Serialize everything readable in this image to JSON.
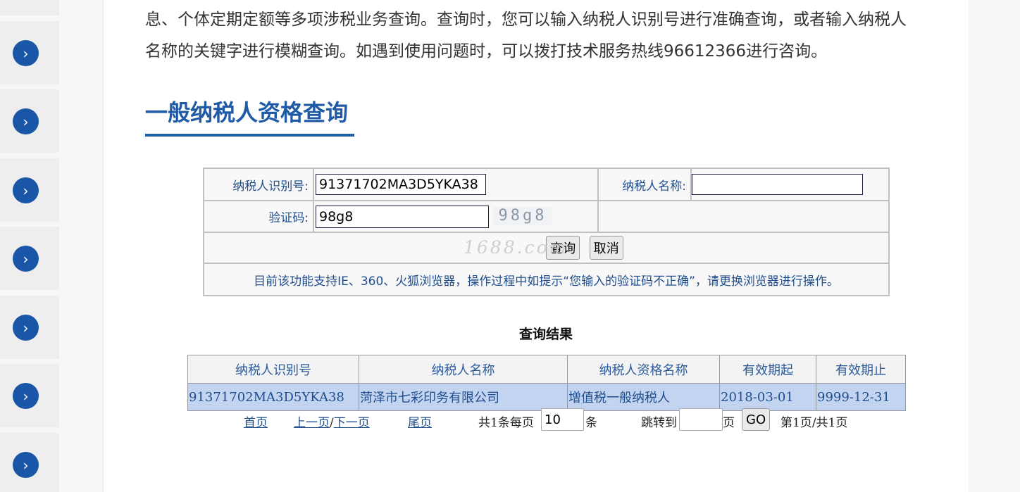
{
  "intro": {
    "line1": "息、个体定期定额等多项涉税业务查询。查询时，您可以输入纳税人识别号进行准确查询，或者输入纳税人",
    "line2": "名称的关键字进行模糊查询。如遇到使用问题时，可以拨打技术服务热线96612366进行咨询。"
  },
  "page_title": "一般纳税人资格查询",
  "form": {
    "taxpayer_id_label": "纳税人识别号:",
    "taxpayer_id_value": "91371702MA3D5YKA38",
    "taxpayer_name_label": "纳税人名称:",
    "taxpayer_name_value": "",
    "captcha_label": "验证码:",
    "captcha_value": "98g8",
    "captcha_image_text": "98g8",
    "query_button": "查询",
    "cancel_button": "取消",
    "notice": "目前该功能支持IE、360、火狐浏览器，操作过程中如提示“您输入的验证码不正确”，请更换浏览器进行操作。",
    "watermark": "1688.com"
  },
  "results": {
    "caption": "查询结果",
    "headers": [
      "纳税人识别号",
      "纳税人名称",
      "纳税人资格名称",
      "有效期起",
      "有效期止"
    ],
    "rows": [
      [
        "91371702MA3D5YKA38",
        "菏泽市七彩印务有限公司",
        "增值税一般纳税人",
        "2018-03-01",
        "9999-12-31"
      ]
    ]
  },
  "pager": {
    "first": "首页",
    "prev": "上一页",
    "separator": "/",
    "next": "下一页",
    "last": "尾页",
    "total_prefix": "共1条每页",
    "page_size": "10",
    "unit": "条",
    "jump_label": "跳转到",
    "jump_value": "",
    "page_unit": "页",
    "go_button": "GO",
    "page_status": "第1页/共1页"
  },
  "sidebar": {
    "button_icon": "chevron-right-icon",
    "button_count": 7
  },
  "colors": {
    "accent": "#1f5aa6",
    "sidebar_button": "#1a56a8",
    "result_row": "#c2d4ef"
  }
}
